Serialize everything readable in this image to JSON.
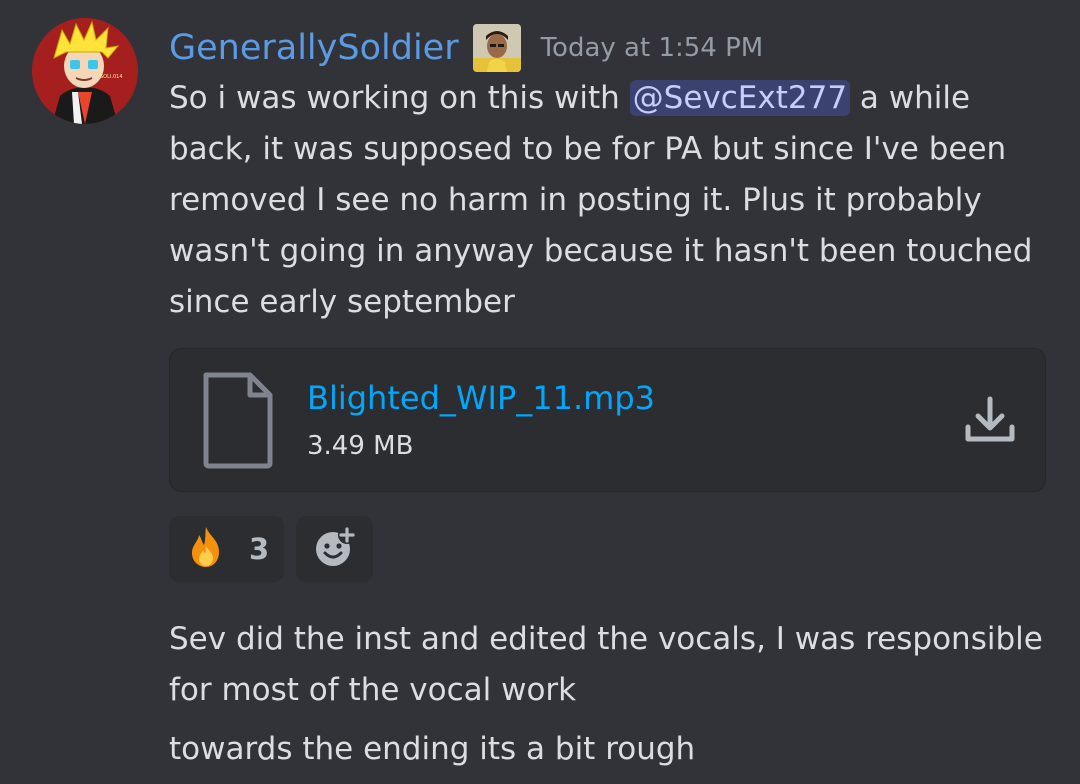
{
  "message": {
    "author": "GenerallySoldier",
    "timestamp": "Today at 1:54 PM",
    "text_before_mention": "So i was working on this with ",
    "mention": "@SevcExt277",
    "text_after_mention": " a while back, it was supposed to be for PA but since I've been removed I see no harm in posting it. Plus it probably wasn't going in anyway because it hasn't been touched since early september"
  },
  "attachment": {
    "file_name": "Blighted_WIP_11.mp3",
    "file_size": "3.49 MB",
    "icon": "file-icon",
    "action_icon": "download-icon"
  },
  "reactions": [
    {
      "emoji": "🔥",
      "count": "3"
    },
    {
      "icon": "add-reaction-icon"
    }
  ],
  "followups": [
    "Sev did the inst and edited the vocals, I was responsible for most of the vocal work",
    "towards the ending its a bit rough"
  ],
  "colors": {
    "background": "#313338",
    "username": "#5b9be4",
    "link": "#00a8fc",
    "mention_bg": "#3c4270"
  }
}
